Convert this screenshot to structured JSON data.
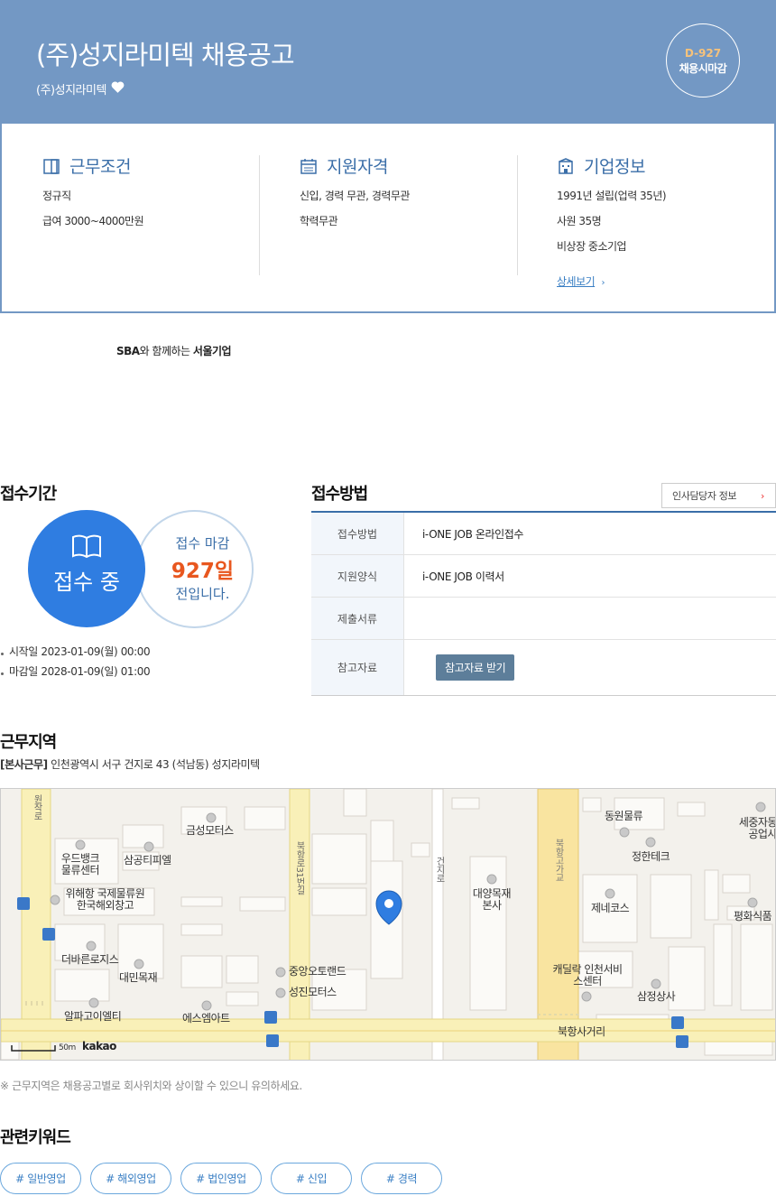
{
  "header": {
    "title": "(주)성지라미텍 채용공고",
    "company": "(주)성지라미텍",
    "dday": "D-927",
    "deadline_type": "채용시마감"
  },
  "conditions": {
    "title": "근무조건",
    "items": [
      "정규직",
      "급여 3000~4000만원"
    ]
  },
  "qualifications": {
    "title": "지원자격",
    "items": [
      "신입, 경력 무관, 경력무관",
      "학력무관"
    ]
  },
  "company_info": {
    "title": "기업정보",
    "items": [
      "1991년 설립(업력 35년)",
      "사원 35명",
      "비상장 중소기업"
    ],
    "more_link": "상세보기"
  },
  "sba": {
    "prefix": "SBA",
    "middle": "와 함께하는 ",
    "suffix": "서울기업"
  },
  "period": {
    "title": "접수기간",
    "status": "접수 중",
    "remain_label": "접수 마감",
    "remain_days": "927일",
    "remain_suffix": "전입니다.",
    "start": "시작일 2023-01-09(월) 00:00",
    "end": "마감일 2028-01-09(일) 01:00"
  },
  "method": {
    "title": "접수방법",
    "hr_button": "인사담당자 정보",
    "rows": [
      {
        "label": "접수방법",
        "value": "i-ONE JOB 온라인접수"
      },
      {
        "label": "지원양식",
        "value": "i-ONE JOB 이력서"
      },
      {
        "label": "제출서류",
        "value": ""
      },
      {
        "label": "참고자료",
        "button": "참고자료 받기"
      }
    ]
  },
  "work_area": {
    "title": "근무지역",
    "tag": "[본사근무]",
    "address": " 인천광역시 서구 건지로 43 (석남동) 성지라미텍",
    "map": {
      "scale": "50m",
      "brand": "kakao",
      "labels": [
        "금성모터스",
        "우드뱅크 물류센터",
        "삼공티피엘",
        "위해항 국제물류원 한국해외창고",
        "더바른로지스",
        "대민목재",
        "알파고이엘티",
        "에스엠아트",
        "중앙오토랜드",
        "성진모터스",
        "대양목재 본사",
        "동원물류",
        "정한테크",
        "세중자동 공업사",
        "제네코스",
        "평화식품",
        "캐딜락 인천서비스센터",
        "삼정상사",
        "북항사거리",
        "원작로",
        "북항로31번길",
        "건지로",
        "북항고가교"
      ]
    },
    "note": "※ 근무지역은 채용공고별로 회사위치와 상이할 수 있으니 유의하세요."
  },
  "keywords": {
    "title": "관련키워드",
    "items": [
      "# 일반영업",
      "# 해외영업",
      "# 법인영업",
      "# 신입",
      "# 경력"
    ]
  },
  "colors": {
    "header_bg": "#7398c4",
    "accent_blue": "#2f7de1",
    "orange": "#e8571f"
  }
}
